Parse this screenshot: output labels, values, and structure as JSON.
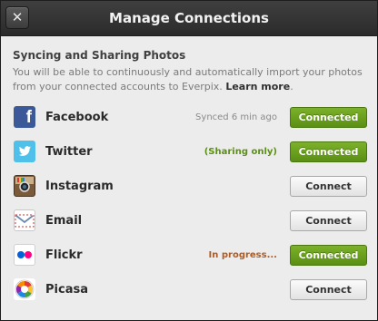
{
  "dialog": {
    "title": "Manage Connections",
    "close_label": "✕"
  },
  "intro": {
    "heading": "Syncing and Sharing Photos",
    "description": "You will be able to continuously and automatically import your photos from your connected accounts to Everpix. ",
    "learn_more": "Learn more",
    "trailing": "."
  },
  "services": [
    {
      "name": "Facebook",
      "status": "Synced 6 min ago",
      "status_color": "#8a8a8a",
      "button": "Connected",
      "connected": true,
      "icon": "facebook-icon"
    },
    {
      "name": "Twitter",
      "status": "(Sharing only)",
      "status_color": "#5c8f16",
      "button": "Connected",
      "connected": true,
      "icon": "twitter-icon"
    },
    {
      "name": "Instagram",
      "status": "",
      "status_color": "#8a8a8a",
      "button": "Connect",
      "connected": false,
      "icon": "instagram-icon"
    },
    {
      "name": "Email",
      "status": "",
      "status_color": "#8a8a8a",
      "button": "Connect",
      "connected": false,
      "icon": "email-icon"
    },
    {
      "name": "Flickr",
      "status": "In progress...",
      "status_color": "#b35a1f",
      "button": "Connected",
      "connected": true,
      "icon": "flickr-icon"
    },
    {
      "name": "Picasa",
      "status": "",
      "status_color": "#8a8a8a",
      "button": "Connect",
      "connected": false,
      "icon": "picasa-icon"
    }
  ],
  "colors": {
    "connected_green": "#6aa21f",
    "titlebar": "#333333"
  }
}
